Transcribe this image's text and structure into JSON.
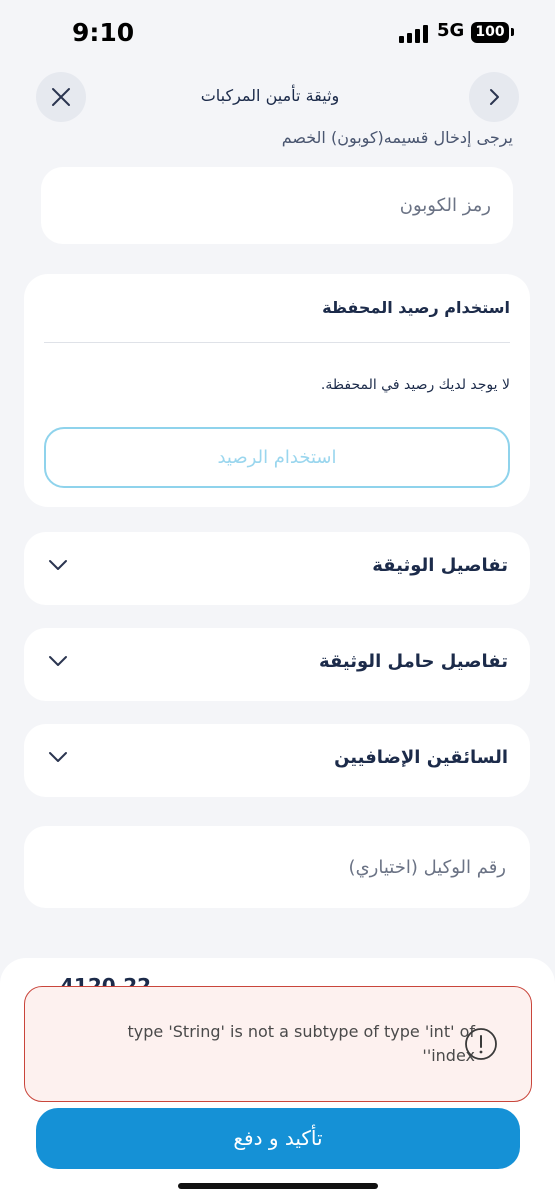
{
  "status_bar": {
    "time": "9:10",
    "network": "5G",
    "battery": "100"
  },
  "header": {
    "title": "وثيقة تأمين المركبات",
    "close_icon": "close-icon",
    "forward_icon": "chevron-right-icon"
  },
  "coupon": {
    "hint": "يرجى إدخال قسيمه(كوبون) الخصم",
    "placeholder": "رمز الكوبون",
    "value": ""
  },
  "wallet": {
    "title": "استخدام رصيد المحفظة",
    "message": "لا يوجد لديك رصيد في المحفظة.",
    "button_label": "استخدام الرصيد"
  },
  "sections": [
    {
      "label": "تفاصيل الوثيقة",
      "icon": "chevron-down-icon"
    },
    {
      "label": "تفاصيل حامل الوثيقة",
      "icon": "chevron-down-icon"
    },
    {
      "label": "السائقين الإضافيين",
      "icon": "chevron-down-icon"
    }
  ],
  "agent": {
    "placeholder": "رقم الوكيل (اختياري)",
    "value": ""
  },
  "summary": {
    "total_partial": "4120.22"
  },
  "error": {
    "message": "type 'String' is not a subtype of type 'int' of ''index",
    "icon": "alert-circle-icon",
    "border_color": "#c9453b",
    "background_color": "#fdf1ef"
  },
  "footer": {
    "confirm_label": "تأكيد و دفع",
    "accent_color": "#1591d6"
  }
}
